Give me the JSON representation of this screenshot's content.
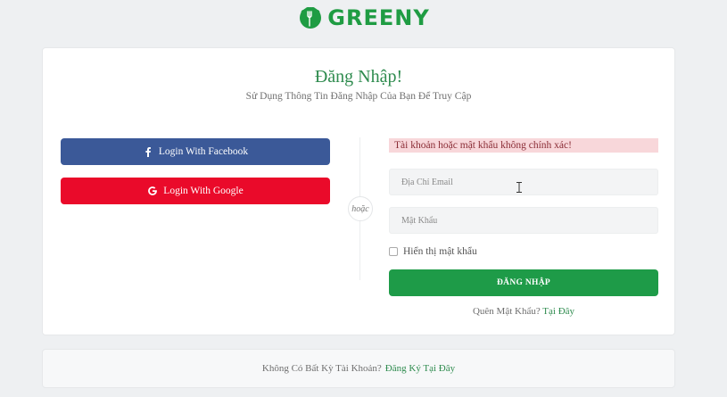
{
  "brand": {
    "name": "GREENY",
    "logo_icon": "fork-leaf-icon",
    "color": "#1f9c43"
  },
  "login": {
    "title": "Đăng Nhập!",
    "subtitle": "Sử Dụng Thông Tin Đăng Nhập Của Bạn Để Truy Cập",
    "facebook_label": "Login With Facebook",
    "google_label": "Login With Google",
    "or_label": "hoặc",
    "error_message": "Tài khoản hoặc mật khẩu không chính xác!",
    "email_placeholder": "Địa Chỉ Email",
    "email_value": "",
    "password_placeholder": "Mật Khẩu",
    "password_value": "",
    "show_password_label": "Hiển thị mật khẩu",
    "show_password_checked": false,
    "submit_label": "ĐĂNG NHẬP",
    "forgot_text": "Quên Mật Khẩu?",
    "forgot_link": "Tại Đây"
  },
  "footer": {
    "text": "Không Có Bất Kỳ Tài Khoản?",
    "link": "Đăng Ký Tại Đây"
  },
  "colors": {
    "accent": "#1e9b48",
    "facebook": "#3b5998",
    "google": "#ea0a2a",
    "error_bg": "#f8d7da"
  }
}
